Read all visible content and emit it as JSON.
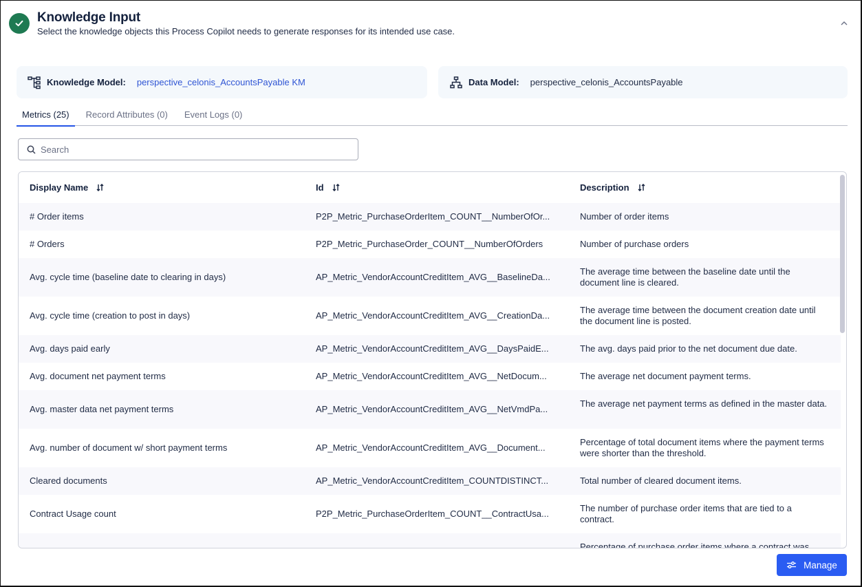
{
  "header": {
    "title": "Knowledge Input",
    "subtitle": "Select the knowledge objects this Process Copilot needs to generate responses for its intended use case.",
    "status_icon": "check-circle-icon",
    "collapse_icon": "chevron-up-icon",
    "status_color": "#1e7a52"
  },
  "knowledge_model": {
    "icon": "tree-structure-icon",
    "label": "Knowledge Model:",
    "value": "perspective_celonis_AccountsPayable KM"
  },
  "data_model": {
    "icon": "hierarchy-icon",
    "label": "Data Model:",
    "value": "perspective_celonis_AccountsPayable"
  },
  "tabs": [
    {
      "label": "Metrics (25)",
      "active": true
    },
    {
      "label": "Record Attributes (0)",
      "active": false
    },
    {
      "label": "Event Logs (0)",
      "active": false
    }
  ],
  "search": {
    "placeholder": "Search",
    "value": ""
  },
  "table": {
    "columns": [
      {
        "label": "Display Name",
        "sortable": true
      },
      {
        "label": "Id",
        "sortable": true
      },
      {
        "label": "Description",
        "sortable": true
      }
    ],
    "rows": [
      {
        "name": "# Order items",
        "id": "P2P_Metric_PurchaseOrderItem_COUNT__NumberOfOr...",
        "description": "Number of order items"
      },
      {
        "name": "# Orders",
        "id": "P2P_Metric_PurchaseOrder_COUNT__NumberOfOrders",
        "description": "Number of purchase orders"
      },
      {
        "name": "Avg. cycle time (baseline date to clearing in days)",
        "id": "AP_Metric_VendorAccountCreditItem_AVG__BaselineDa...",
        "description": "The average time between the baseline date until the document line is cleared."
      },
      {
        "name": "Avg. cycle time (creation to post in days)",
        "id": "AP_Metric_VendorAccountCreditItem_AVG__CreationDa...",
        "description": "The average time between the document creation date until the document line is posted."
      },
      {
        "name": "Avg. days paid early",
        "id": "AP_Metric_VendorAccountCreditItem_AVG__DaysPaidE...",
        "description": "The avg. days paid prior to the net document due date."
      },
      {
        "name": "Avg. document net payment terms",
        "id": "AP_Metric_VendorAccountCreditItem_AVG__NetDocum...",
        "description": "The average net document payment terms."
      },
      {
        "name": "Avg. master data net payment terms",
        "id": "AP_Metric_VendorAccountCreditItem_AVG__NetVmdPa...",
        "description": "The average net payment terms as defined in the master data."
      },
      {
        "name": "Avg. number of document w/ short payment terms",
        "id": "AP_Metric_VendorAccountCreditItem_AVG__Document...",
        "description": "Percentage of total document items where the payment terms were shorter than the threshold."
      },
      {
        "name": "Cleared documents",
        "id": "AP_Metric_VendorAccountCreditItem_COUNTDISTINCT...",
        "description": "Total number of cleared document items."
      },
      {
        "name": "Contract Usage count",
        "id": "P2P_Metric_PurchaseOrderItem_COUNT__ContractUsa...",
        "description": "The number of purchase order items that are tied to a contract."
      },
      {
        "name": "",
        "id": "",
        "description": "Percentage of purchase order items where a contract was"
      }
    ]
  },
  "footer": {
    "manage_label": "Manage",
    "manage_icon": "sliders-icon",
    "accent_color": "#2a5cf2"
  }
}
